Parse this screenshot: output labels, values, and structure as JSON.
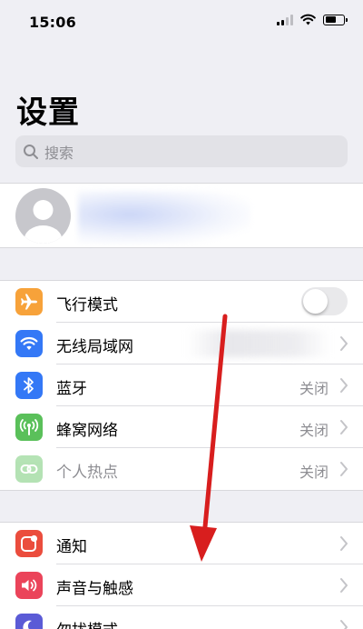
{
  "status_bar": {
    "time": "15:06"
  },
  "page": {
    "title": "设置"
  },
  "search": {
    "placeholder": "搜索"
  },
  "group1": {
    "airplane": {
      "label": "飞行模式",
      "icon": "airplane-icon",
      "color": "#f7a23a",
      "toggle_on": false
    },
    "wifi": {
      "label": "无线局域网",
      "icon": "wifi-icon",
      "color": "#3478f6"
    },
    "bluetooth": {
      "label": "蓝牙",
      "value": "关闭",
      "icon": "bluetooth-icon",
      "color": "#3478f6"
    },
    "cellular": {
      "label": "蜂窝网络",
      "value": "关闭",
      "icon": "antenna-icon",
      "color": "#5ac05a"
    },
    "hotspot": {
      "label": "个人热点",
      "value": "关闭",
      "icon": "hotspot-icon",
      "color": "#5ac05a"
    }
  },
  "group2": {
    "notifications": {
      "label": "通知",
      "icon": "notifications-icon",
      "color": "#eb4d3d"
    },
    "sounds": {
      "label": "声音与触感",
      "icon": "speaker-icon",
      "color": "#eb445a"
    },
    "dnd": {
      "label": "勿扰模式",
      "icon": "moon-icon",
      "color": "#5b5bd6"
    }
  },
  "annotation": {
    "arrow_color": "#d81e1e"
  }
}
